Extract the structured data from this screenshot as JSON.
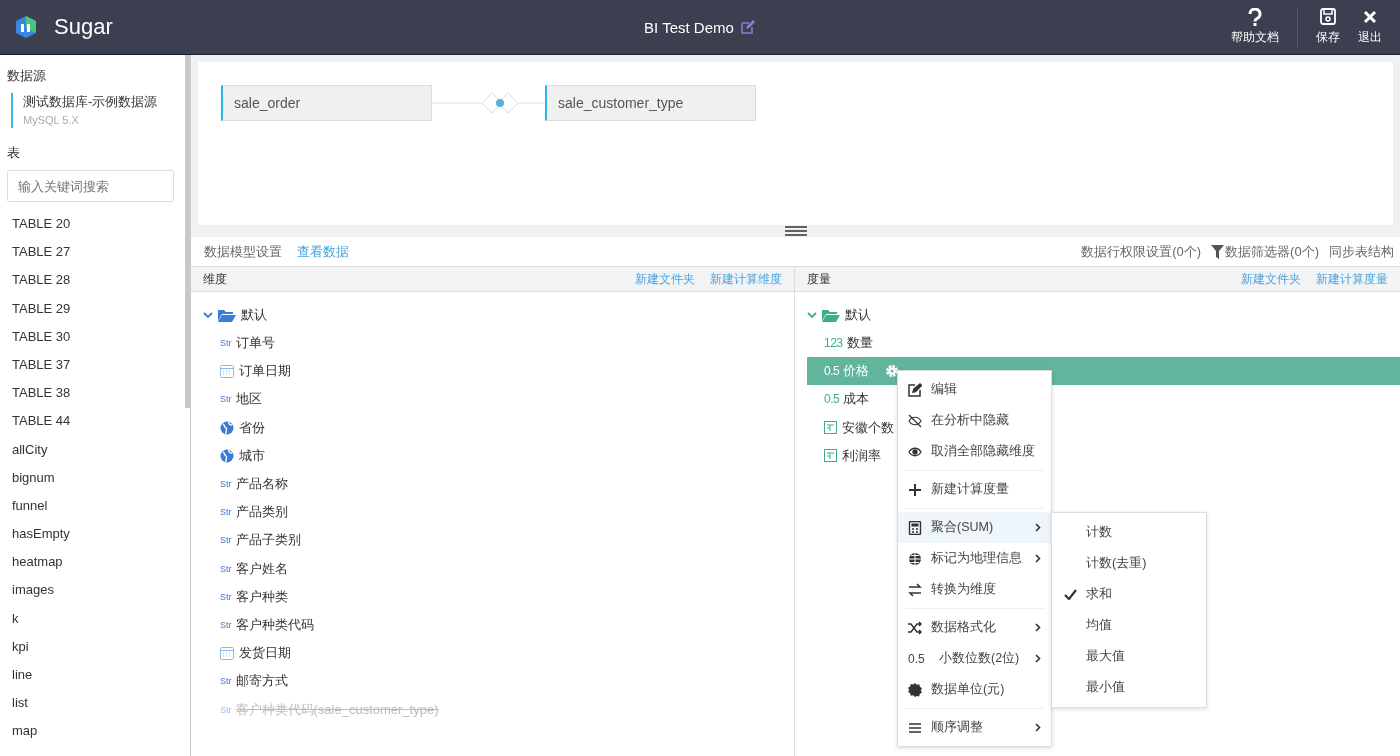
{
  "header": {
    "brand": "Sugar",
    "title": "BI Test Demo",
    "actions": [
      {
        "kind": "help",
        "label": "帮助文档"
      },
      {
        "kind": "save",
        "label": "保存"
      },
      {
        "kind": "exit",
        "label": "退出"
      }
    ]
  },
  "sidebar": {
    "datasource_heading": "数据源",
    "datasource": {
      "name": "测试数据库-示例数据源",
      "type": "MySQL 5.X"
    },
    "tables_heading": "表",
    "search": {
      "placeholder": "输入关键词搜索"
    },
    "tables": [
      "TABLE 20",
      "TABLE 27",
      "TABLE 28",
      "TABLE 29",
      "TABLE 30",
      "TABLE 37",
      "TABLE 38",
      "TABLE 44",
      "allCity",
      "bignum",
      "funnel",
      "hasEmpty",
      "heatmap",
      "images",
      "k",
      "kpi",
      "line",
      "list",
      "map"
    ]
  },
  "canvas": {
    "nodes": [
      "sale_order",
      "sale_customer_type"
    ]
  },
  "toolbar": {
    "title": "数据模型设置",
    "view_link": "查看数据",
    "actions": [
      {
        "kind": "text",
        "label": "数据行权限设置(0个)"
      },
      {
        "kind": "filter",
        "label": "数据筛选器(0个)"
      },
      {
        "kind": "text",
        "label": "同步表结构"
      }
    ]
  },
  "dimensions": {
    "heading": "维度",
    "links": [
      "新建文件夹",
      "新建计算维度"
    ],
    "folder": {
      "name": "默认",
      "expanded": true,
      "children": [
        {
          "kind": "str",
          "type_label": "Str",
          "name": "订单号",
          "disabled": false
        },
        {
          "kind": "date",
          "name": "订单日期",
          "disabled": false
        },
        {
          "kind": "str",
          "type_label": "Str",
          "name": "地区",
          "disabled": false
        },
        {
          "kind": "geo",
          "name": "省份",
          "disabled": false
        },
        {
          "kind": "geo",
          "name": "城市",
          "disabled": false
        },
        {
          "kind": "str",
          "type_label": "Str",
          "name": "产品名称",
          "disabled": false
        },
        {
          "kind": "str",
          "type_label": "Str",
          "name": "产品类别",
          "disabled": false
        },
        {
          "kind": "str",
          "type_label": "Str",
          "name": "产品子类别",
          "disabled": false
        },
        {
          "kind": "str",
          "type_label": "Str",
          "name": "客户姓名",
          "disabled": false
        },
        {
          "kind": "str",
          "type_label": "Str",
          "name": "客户种类",
          "disabled": false
        },
        {
          "kind": "str",
          "type_label": "Str",
          "name": "客户种类代码",
          "disabled": false
        },
        {
          "kind": "date",
          "name": "发货日期",
          "disabled": false
        },
        {
          "kind": "str",
          "type_label": "Str",
          "name": "邮寄方式",
          "disabled": false
        },
        {
          "kind": "str",
          "type_label": "Str",
          "name": "客户种类代码(sale_customer_type)",
          "disabled": true
        }
      ]
    }
  },
  "measures": {
    "heading": "度量",
    "links": [
      "新建文件夹",
      "新建计算度量"
    ],
    "folder": {
      "name": "默认",
      "expanded": true,
      "children": [
        {
          "kind": "num",
          "type_label": "123",
          "name": "数量",
          "selected": false
        },
        {
          "kind": "num",
          "type_label": "0.5",
          "name": "价格",
          "selected": true
        },
        {
          "kind": "num",
          "type_label": "0.5",
          "name": "成本",
          "selected": false
        },
        {
          "kind": "calc",
          "name": "安徽个数",
          "selected": false
        },
        {
          "kind": "calc",
          "name": "利润率",
          "selected": false
        }
      ]
    }
  },
  "context_menu": {
    "groups": [
      [
        {
          "kind": "edit",
          "label": "编辑",
          "submenu": false,
          "selected": false
        },
        {
          "kind": "hide",
          "label": "在分析中隐藏",
          "submenu": false,
          "selected": false
        },
        {
          "kind": "show",
          "label": "取消全部隐藏维度",
          "submenu": false,
          "selected": false
        }
      ],
      [
        {
          "kind": "add",
          "label": "新建计算度量",
          "submenu": false,
          "selected": false
        }
      ],
      [
        {
          "kind": "calculator",
          "label": "聚合(SUM)",
          "submenu": true,
          "selected": true
        },
        {
          "kind": "globe",
          "label": "标记为地理信息",
          "submenu": true,
          "selected": false
        },
        {
          "kind": "swap",
          "label": "转换为维度",
          "submenu": false,
          "selected": false
        }
      ],
      [
        {
          "kind": "shuffle",
          "label": "数据格式化",
          "submenu": true,
          "selected": false
        },
        {
          "kind": "text",
          "prefix": "0.5",
          "label": "小数位数(2位)",
          "submenu": true,
          "selected": false
        },
        {
          "kind": "badge",
          "label": "数据单位(元)",
          "submenu": false,
          "selected": false
        }
      ],
      [
        {
          "kind": "list",
          "label": "顺序调整",
          "submenu": true,
          "selected": false
        }
      ]
    ]
  },
  "submenu": {
    "items": [
      {
        "label": "计数",
        "checked": false
      },
      {
        "label": "计数(去重)",
        "checked": false
      },
      {
        "label": "求和",
        "checked": true
      },
      {
        "label": "均值",
        "checked": false
      },
      {
        "label": "最大值",
        "checked": false
      },
      {
        "label": "最小值",
        "checked": false
      }
    ]
  }
}
